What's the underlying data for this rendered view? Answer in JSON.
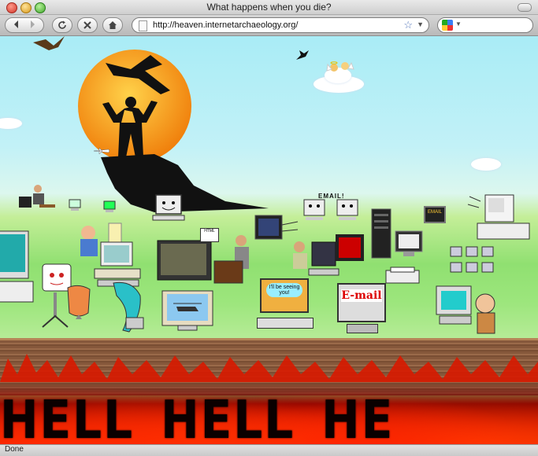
{
  "window": {
    "title": "What happens when you die?"
  },
  "toolbar": {
    "back_icon": "back-arrow-icon",
    "forward_icon": "forward-arrow-icon",
    "url": "http://heaven.internetarchaeology.org/",
    "search_placeholder": ""
  },
  "page": {
    "email_sign": "EMAIL!",
    "email_monitor_label": "E-mail",
    "bubble_text": "I'll be seeing you!",
    "small_monitor_label": "EMAIL",
    "hell_words": [
      "HELL",
      "HELL",
      "HE"
    ],
    "colors": {
      "sky": "#a9ecf6",
      "grass": "#90e071",
      "sun": "#f59a1e",
      "fire": "#ff2a00"
    }
  },
  "status": {
    "text": "Done"
  }
}
